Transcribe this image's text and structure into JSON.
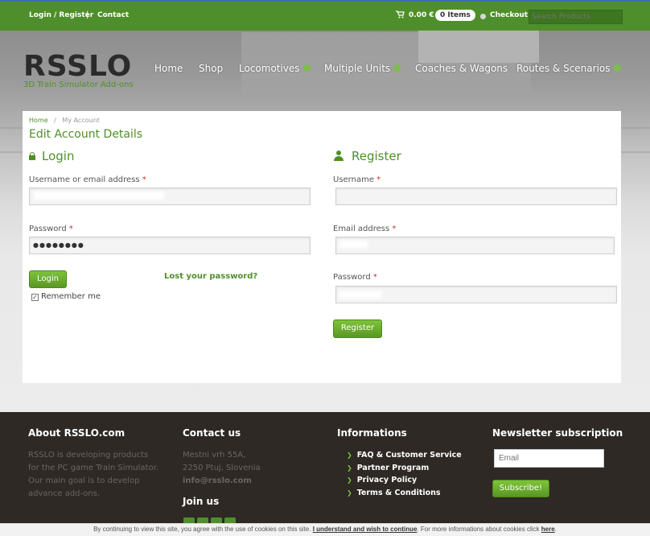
{
  "topbar": {
    "login_register": "Login / Register",
    "separator": "|",
    "contact": "Contact",
    "cart_icon": "cart-icon",
    "cart_amount": "0.00 €",
    "cart_items": "0 Items",
    "checkout": "Checkout",
    "search_placeholder": "Search Products"
  },
  "brand": {
    "logo": "RSSLO",
    "tagline": "3D Train Simulator Add-ons"
  },
  "nav": {
    "items": [
      {
        "label": "Home",
        "has_dropdown": false
      },
      {
        "label": "Shop",
        "has_dropdown": false
      },
      {
        "label": "Locomotives",
        "has_dropdown": true
      },
      {
        "label": "Multiple Units",
        "has_dropdown": true
      },
      {
        "label": "Coaches & Wagons",
        "has_dropdown": false
      },
      {
        "label": "Routes & Scenarios",
        "has_dropdown": true
      }
    ]
  },
  "breadcrumb": {
    "home": "Home",
    "sep": "/",
    "current": "My Account"
  },
  "page_title": "Edit Account Details",
  "login": {
    "title": "Login",
    "username_label": "Username or email address",
    "required": "*",
    "password_label": "Password",
    "password_value": "●●●●●●●●",
    "button": "Login",
    "lost_password": "Lost your password?",
    "remember_me": "Remember me",
    "remember_checked": true
  },
  "register": {
    "title": "Register",
    "username_label": "Username",
    "email_label": "Email address",
    "password_label": "Password",
    "required": "*",
    "button": "Register"
  },
  "footer": {
    "about_title": "About RSSLO.com",
    "about_text": [
      "RSSLO is developing products",
      "for the PC game Train Simulator.",
      "Our main goal is to develop",
      "advance add-ons."
    ],
    "contact_title": "Contact us",
    "contact_lines": [
      "Mestni vrh 55A,",
      "2250 Ptuj, Slovenia"
    ],
    "contact_email": "info@rsslo.com",
    "join_title": "Join us",
    "info_title": "Informations",
    "info_links": [
      "FAQ & Customer Service",
      "Partner Program",
      "Privacy Policy",
      "Terms & Conditions"
    ],
    "newsletter_title": "Newsletter subscription",
    "newsletter_placeholder": "Email",
    "subscribe": "Subscribe!"
  },
  "cookie": {
    "text_before": "By continuing to view this site, you agree with the use of cookies on this site.",
    "accept_link": "I understand and wish to continue",
    "text_middle": ". For more informations about cookies click",
    "here_link": "here",
    "text_end": "."
  },
  "colors": {
    "brand_green": "#4f8f2b",
    "accent_green": "#7dbd4a",
    "footer_bg": "#2e2924"
  }
}
